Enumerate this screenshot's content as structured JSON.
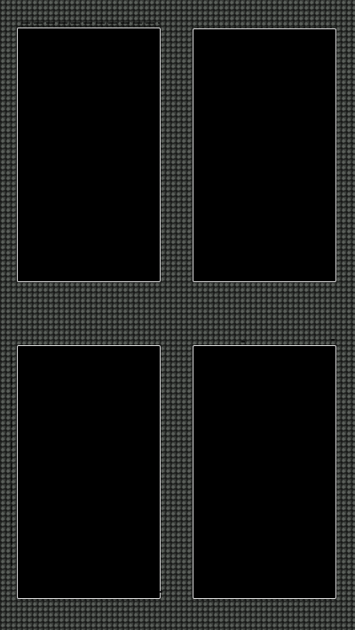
{
  "layout": {
    "type": "2x2-grid"
  },
  "tiles": [
    {
      "id": "tile-1",
      "state": "blank"
    },
    {
      "id": "tile-2",
      "state": "blank"
    },
    {
      "id": "tile-3",
      "state": "blank"
    },
    {
      "id": "tile-4",
      "state": "blank"
    }
  ],
  "colors": {
    "background": "#3a3d3a",
    "tile_fill": "#000000",
    "tile_border": "#d9d9d9"
  }
}
